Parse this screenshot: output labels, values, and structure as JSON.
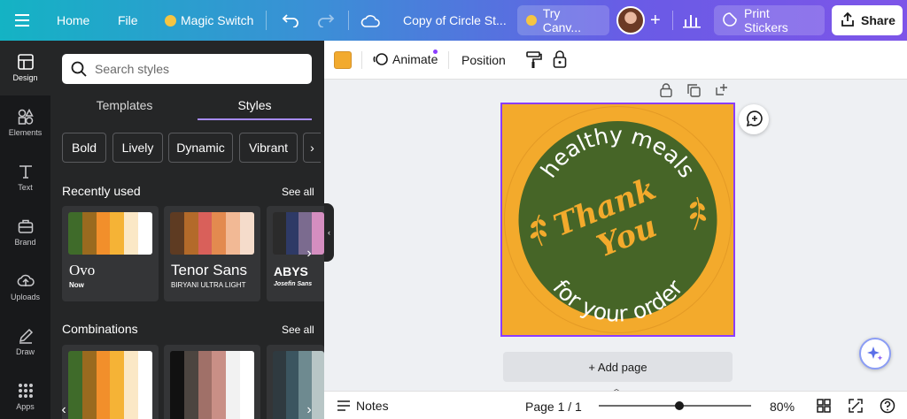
{
  "topbar": {
    "home": "Home",
    "file": "File",
    "magic_switch": "Magic Switch",
    "doc_title": "Copy of Circle St...",
    "try_canva": "Try Canv...",
    "print_stickers": "Print Stickers",
    "share": "Share"
  },
  "rail": {
    "design": "Design",
    "elements": "Elements",
    "text": "Text",
    "brand": "Brand",
    "uploads": "Uploads",
    "draw": "Draw",
    "apps": "Apps"
  },
  "panel": {
    "search_placeholder": "Search styles",
    "tab_templates": "Templates",
    "tab_styles": "Styles",
    "chips": [
      "Bold",
      "Lively",
      "Dynamic",
      "Vibrant"
    ],
    "recently_used": "Recently used",
    "see_all": "See all",
    "combinations": "Combinations",
    "cards": [
      {
        "font1": "Ovo",
        "font2": "Now",
        "colors": [
          "#3f6b2a",
          "#9a6a1f",
          "#f28f2b",
          "#f5b336",
          "#fbe8c6",
          "#ffffff"
        ]
      },
      {
        "font1": "Tenor Sans",
        "font2": "BIRYANI ULTRA LIGHT",
        "colors": [
          "#5e3b22",
          "#b36a2a",
          "#d9605a",
          "#e38a4f",
          "#f2b995",
          "#f5dccb"
        ]
      },
      {
        "font1": "ABYS",
        "font2": "Josefin Sans",
        "colors": [
          "#2b2b2b",
          "#2e3a66",
          "#7b6b8f",
          "#d58ec0"
        ]
      }
    ],
    "combos": [
      {
        "colors": [
          "#3f6b2a",
          "#9a6a1f",
          "#f28f2b",
          "#f5b336",
          "#fbe8c6",
          "#ffffff"
        ]
      },
      {
        "colors": [
          "#111111",
          "#4c4540",
          "#a07068",
          "#c98f86",
          "#f2f2f2",
          "#ffffff"
        ]
      },
      {
        "colors": [
          "#2f3a40",
          "#3b5560",
          "#6e8a90",
          "#b8c6c6"
        ]
      }
    ]
  },
  "toolbar": {
    "color": "#f2aa2e",
    "animate": "Animate",
    "position": "Position"
  },
  "design": {
    "text_top": "healthy meals",
    "text_middle_1": "Thank",
    "text_middle_2": "You",
    "text_bottom": "for your order",
    "bg_color": "#f3aa2c",
    "circle_color": "#466527"
  },
  "canvas": {
    "add_page": "+ Add page"
  },
  "bottombar": {
    "notes": "Notes",
    "page": "Page 1 / 1",
    "zoom": "80%"
  }
}
